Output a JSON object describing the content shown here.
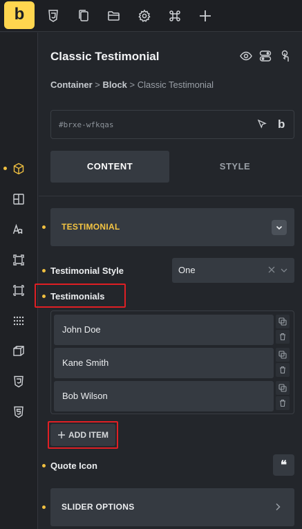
{
  "toolbar": {
    "logo_letter": "b",
    "icons": [
      "css3-icon",
      "pages-icon",
      "folder-icon",
      "settings-icon",
      "command-icon",
      "add-icon"
    ]
  },
  "rail": {
    "icons": [
      "box-icon",
      "layout-icon",
      "typography-icon",
      "element-icon",
      "frame-icon",
      "grid-icon",
      "cube-icon",
      "css3-icon",
      "html5-icon"
    ]
  },
  "panel": {
    "title": "Classic Testimonial",
    "header_icons": [
      "eye-icon",
      "toggle-icon",
      "touch-icon"
    ],
    "breadcrumb": {
      "container": "Container",
      "sep1": ">",
      "block": "Block",
      "sep2": ">",
      "current": "Classic Testimonial"
    },
    "element_id": "#brxe-wfkqas",
    "id_logo": "b",
    "tabs": {
      "content": "CONTENT",
      "style": "STYLE"
    }
  },
  "testimonial_section": {
    "label": "TESTIMONIAL"
  },
  "testimonial_style": {
    "label": "Testimonial Style",
    "value": "One"
  },
  "testimonials": {
    "label": "Testimonials",
    "items": [
      {
        "name": "John Doe"
      },
      {
        "name": "Kane Smith"
      },
      {
        "name": "Bob Wilson"
      }
    ],
    "add_label": "ADD ITEM"
  },
  "quote_icon": {
    "label": "Quote Icon",
    "glyph": "❝"
  },
  "slider_section": {
    "label": "SLIDER OPTIONS"
  },
  "colors": {
    "accent": "#ffd64f",
    "highlight": "#e01f24",
    "section_label": "#f5c542",
    "indicator": "#f0c040"
  }
}
